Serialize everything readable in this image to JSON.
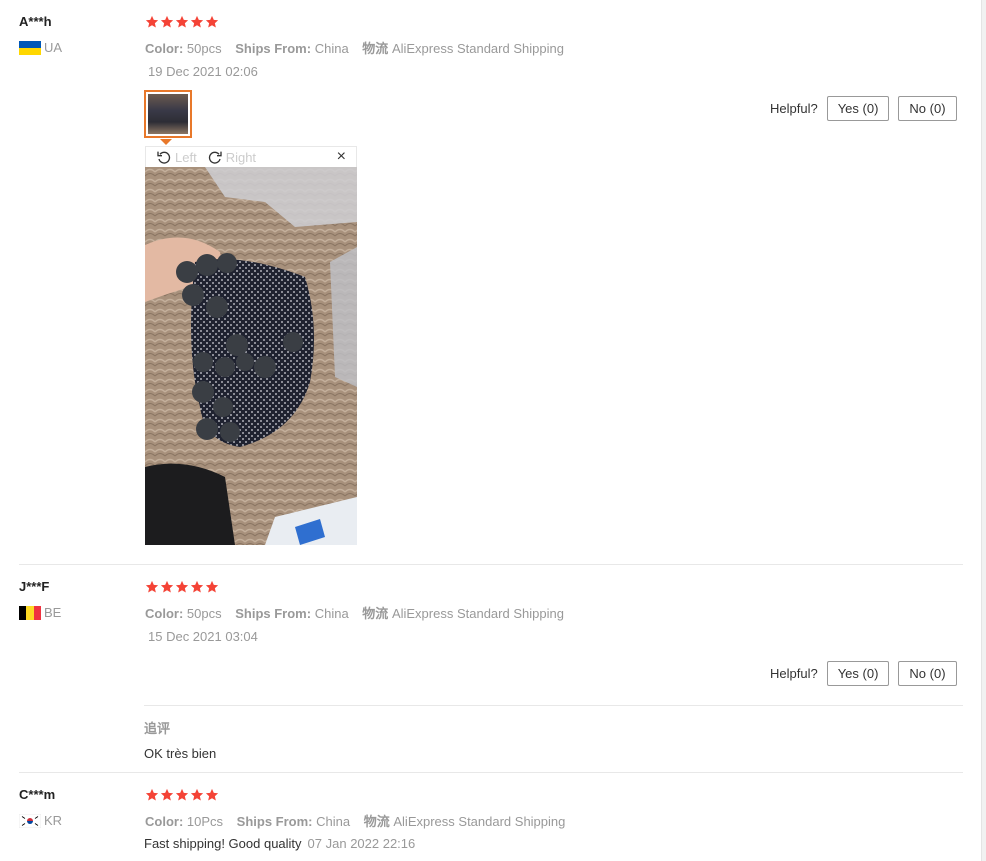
{
  "reviews": [
    {
      "user": "A***h",
      "country": "UA",
      "rating": 5,
      "color_label": "Color:",
      "color_value": "50pcs",
      "ships_label": "Ships From:",
      "ships_value": "China",
      "logistics_label": "物流",
      "logistics_value": "AliExpress Standard Shipping",
      "date": "19 Dec 2021 02:06",
      "helpful_label": "Helpful?",
      "yes_label": "Yes (0)",
      "no_label": "No (0)",
      "viewer": {
        "rotate_left": "Left",
        "rotate_right": "Right",
        "close": "×"
      }
    },
    {
      "user": "J***F",
      "country": "BE",
      "rating": 5,
      "color_label": "Color:",
      "color_value": "50pcs",
      "ships_label": "Ships From:",
      "ships_value": "China",
      "logistics_label": "物流",
      "logistics_value": "AliExpress Standard Shipping",
      "date": "15 Dec 2021 03:04",
      "helpful_label": "Helpful?",
      "yes_label": "Yes (0)",
      "no_label": "No (0)",
      "followup_label": "追评",
      "followup_text": "OK très bien"
    },
    {
      "user": "C***m",
      "country": "KR",
      "rating": 5,
      "color_label": "Color:",
      "color_value": "10Pcs",
      "ships_label": "Ships From:",
      "ships_value": "China",
      "logistics_label": "物流",
      "logistics_value": "AliExpress Standard Shipping",
      "feedback": "Fast shipping! Good quality",
      "date": "07 Jan 2022 22:16"
    }
  ],
  "colors": {
    "star": "#f44336",
    "thumb_border": "#e8782a",
    "muted_text": "#999999",
    "ukraine_blue": "#0057b7",
    "ukraine_yellow": "#ffd700",
    "belgium_black": "#000000",
    "belgium_yellow": "#fdda24",
    "belgium_red": "#ef3340"
  },
  "icons": [
    "star-icon",
    "rotate-left-icon",
    "rotate-right-icon",
    "close-icon",
    "flag-ua-icon",
    "flag-be-icon",
    "flag-kr-icon"
  ]
}
